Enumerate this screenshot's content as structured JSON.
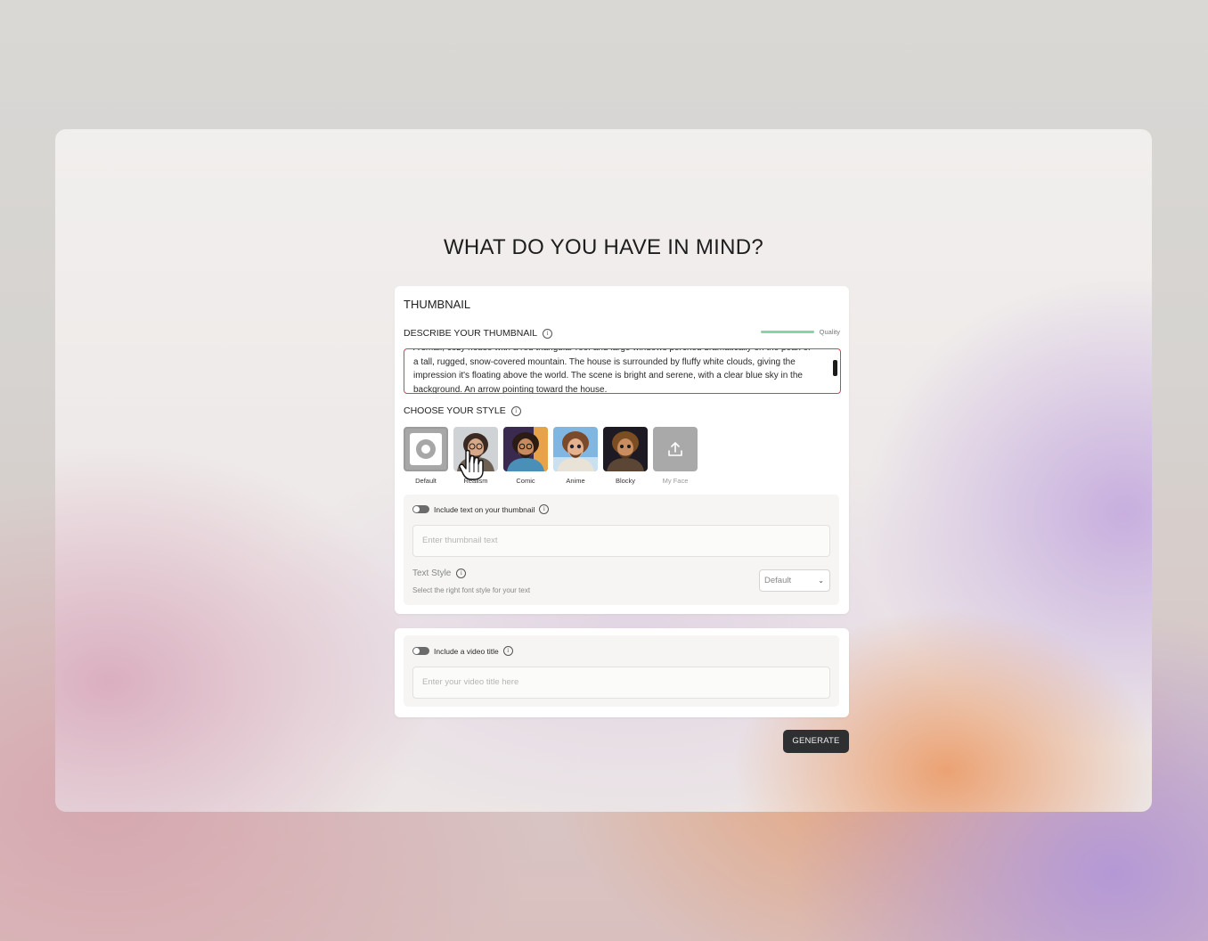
{
  "page": {
    "title": "WHAT DO YOU HAVE IN MIND?"
  },
  "thumbnail_card": {
    "title": "THUMBNAIL",
    "describe_label": "DESCRIBE YOUR THUMBNAIL",
    "quality_label": "Quality",
    "quality_level": 1.0,
    "description": "A small, cozy house with a red triangular roof and large windows perched dramatically on the peak of a tall, rugged, snow-covered mountain. The house is surrounded by fluffy white clouds, giving the impression it's floating above the world. The scene is bright and serene, with a clear blue sky in the background. An arrow pointing toward the house.",
    "style_label": "CHOOSE YOUR STYLE",
    "styles": [
      {
        "name": "Default",
        "icon": "default-style-icon"
      },
      {
        "name": "Realism",
        "icon": "realism-portrait"
      },
      {
        "name": "Comic",
        "icon": "comic-portrait"
      },
      {
        "name": "Anime",
        "icon": "anime-portrait"
      },
      {
        "name": "Blocky",
        "icon": "blocky-portrait"
      },
      {
        "name": "My Face",
        "icon": "upload-icon"
      }
    ],
    "include_text_label": "Include text on your thumbnail",
    "thumbnail_text_placeholder": "Enter thumbnail text",
    "text_style_label": "Text Style",
    "text_style_help": "Select the right font style for your text",
    "text_style_value": "Default"
  },
  "video_title_card": {
    "include_title_label": "Include a video title",
    "title_placeholder": "Enter your video title here"
  },
  "actions": {
    "generate_label": "GENERATE"
  },
  "colors": {
    "accent_dark": "#2d2f31",
    "quality_green": "#8ad3a6",
    "textarea_border": "#c9484e"
  }
}
